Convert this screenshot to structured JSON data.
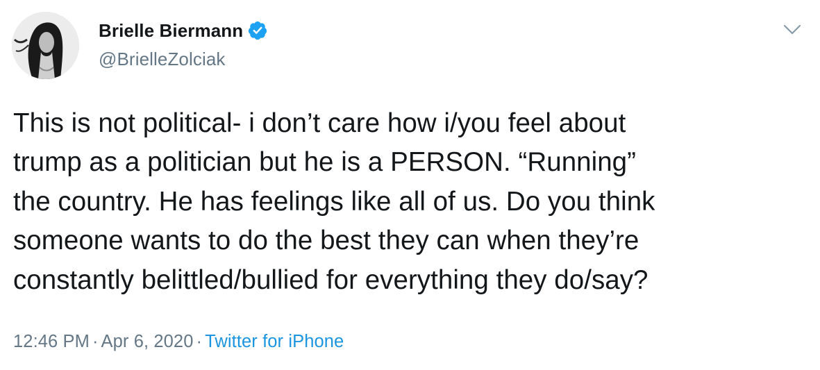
{
  "author": {
    "display_name": "Brielle Biermann",
    "handle": "@BrielleZolciak",
    "verified": true,
    "avatar_icon": "profile-photo",
    "verified_icon": "verified-badge-icon"
  },
  "tweet": {
    "text": "This is not political- i don’t care how i/you feel about\ntrump as a politician but he is a PERSON. “Running”\nthe country. He has feelings like all of us. Do you think\nsomeone wants to do the best they can when they’re\nconstantly belittled/bullied for everything they do/say?"
  },
  "meta": {
    "time": "12:46 PM",
    "separator": "·",
    "date": "Apr 6, 2020",
    "source": "Twitter for iPhone"
  },
  "colors": {
    "primary_text": "#14171a",
    "secondary_text": "#657786",
    "link": "#1b95e0",
    "verified": "#1da1f2",
    "background": "#ffffff"
  },
  "menu": {
    "caret_icon": "chevron-down-icon"
  }
}
